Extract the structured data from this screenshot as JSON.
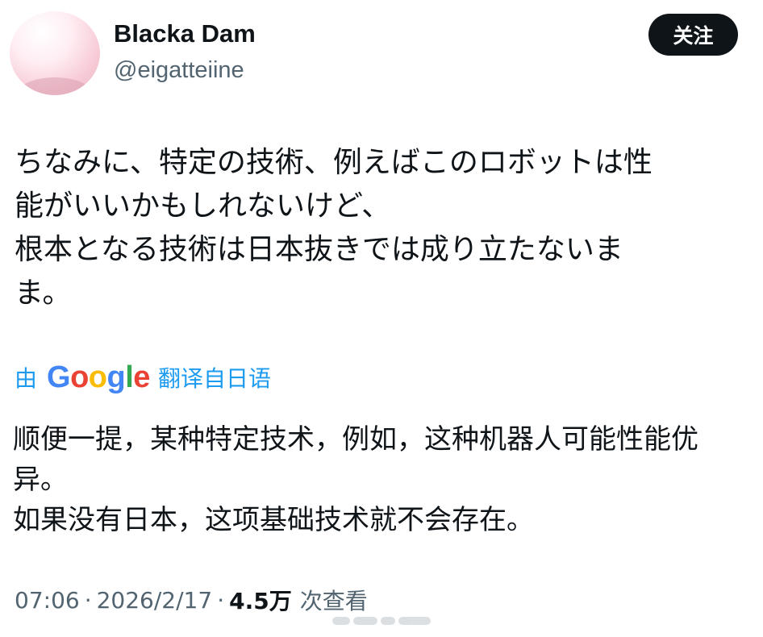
{
  "author": {
    "display_name": "Blacka Dam",
    "handle": "@eigatteiine",
    "avatar_icon": "avatar-image"
  },
  "follow_button": {
    "label": "关注"
  },
  "post": {
    "lines": [
      "ちなみに、特定の技術、例えばこのロボットは性",
      "能がいいかもしれないけど、",
      "根本となる技術は日本抜きでは成り立たないま",
      "ま。"
    ]
  },
  "translation": {
    "prefix": "由",
    "provider_letters": [
      "G",
      "o",
      "o",
      "g",
      "l",
      "e"
    ],
    "suffix": "翻译自日语",
    "lines": [
      "顺便一提，某种特定技术，例如，这种机器人可能性能优",
      "异。",
      "如果没有日本，这项基础技术就不会存在。"
    ]
  },
  "meta": {
    "time": "07:06",
    "separator": "·",
    "date": "2026/2/17",
    "views": "4.5万",
    "views_label": "次查看"
  },
  "colors": {
    "text_primary": "#0f1419",
    "text_secondary": "#536471",
    "link": "#1d9bf0",
    "follow_bg": "#0f1419"
  }
}
